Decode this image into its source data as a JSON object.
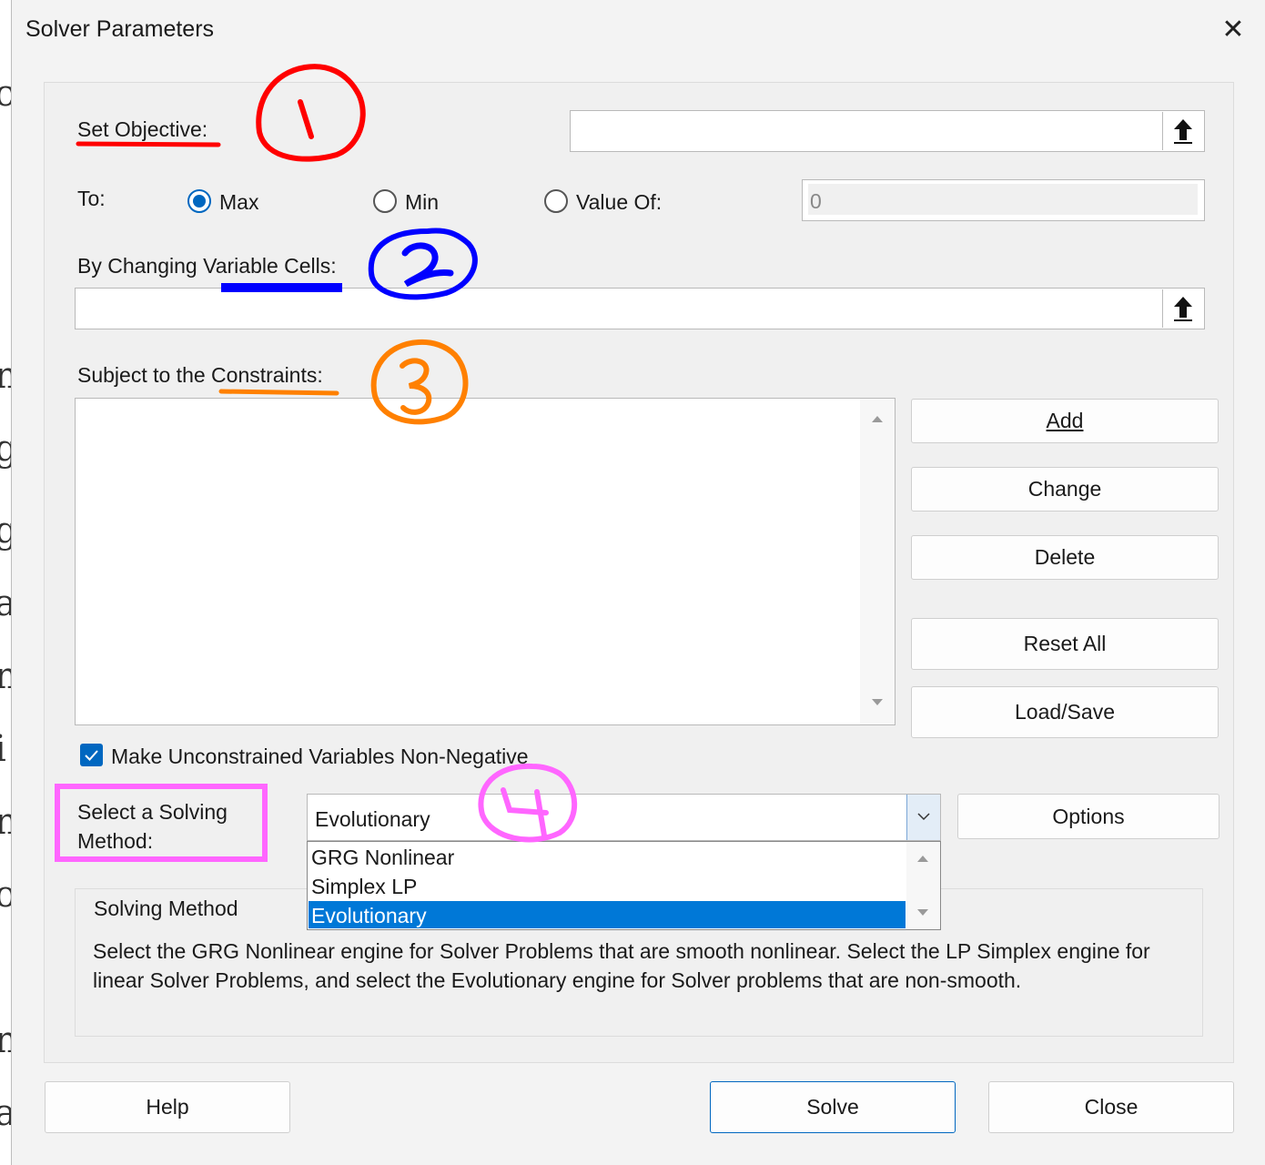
{
  "dialog": {
    "title": "Solver Parameters",
    "close_glyph": "✕"
  },
  "objective": {
    "label": "Set Objective:",
    "value": ""
  },
  "to": {
    "label": "To:",
    "options": [
      "Max",
      "Min",
      "Value Of:"
    ],
    "selected": "Max",
    "value_of": "0"
  },
  "variable_cells": {
    "label": "By Changing Variable Cells:",
    "value": ""
  },
  "constraints": {
    "label": "Subject to the Constraints:",
    "items": [],
    "buttons": [
      "Add",
      "Change",
      "Delete",
      "Reset All",
      "Load/Save"
    ]
  },
  "nonnegative": {
    "label": "Make Unconstrained Variables Non-Negative",
    "checked": true
  },
  "method": {
    "label_line1": "Select a Solving",
    "label_line2": "Method:",
    "selected": "Evolutionary",
    "options": [
      "GRG Nonlinear",
      "Simplex LP",
      "Evolutionary"
    ],
    "options_button": "Options"
  },
  "method_info": {
    "heading": "Solving Method",
    "text": "Select the GRG Nonlinear engine for Solver Problems that are smooth nonlinear. Select the LP Simplex engine for linear Solver Problems, and select the Evolutionary engine for Solver problems that are non-smooth."
  },
  "footer": {
    "help": "Help",
    "solve": "Solve",
    "close": "Close"
  },
  "annotations": {
    "colors": {
      "one": "#ff0000",
      "two": "#0000ff",
      "three": "#ff8000",
      "four": "#ff66ff"
    }
  }
}
